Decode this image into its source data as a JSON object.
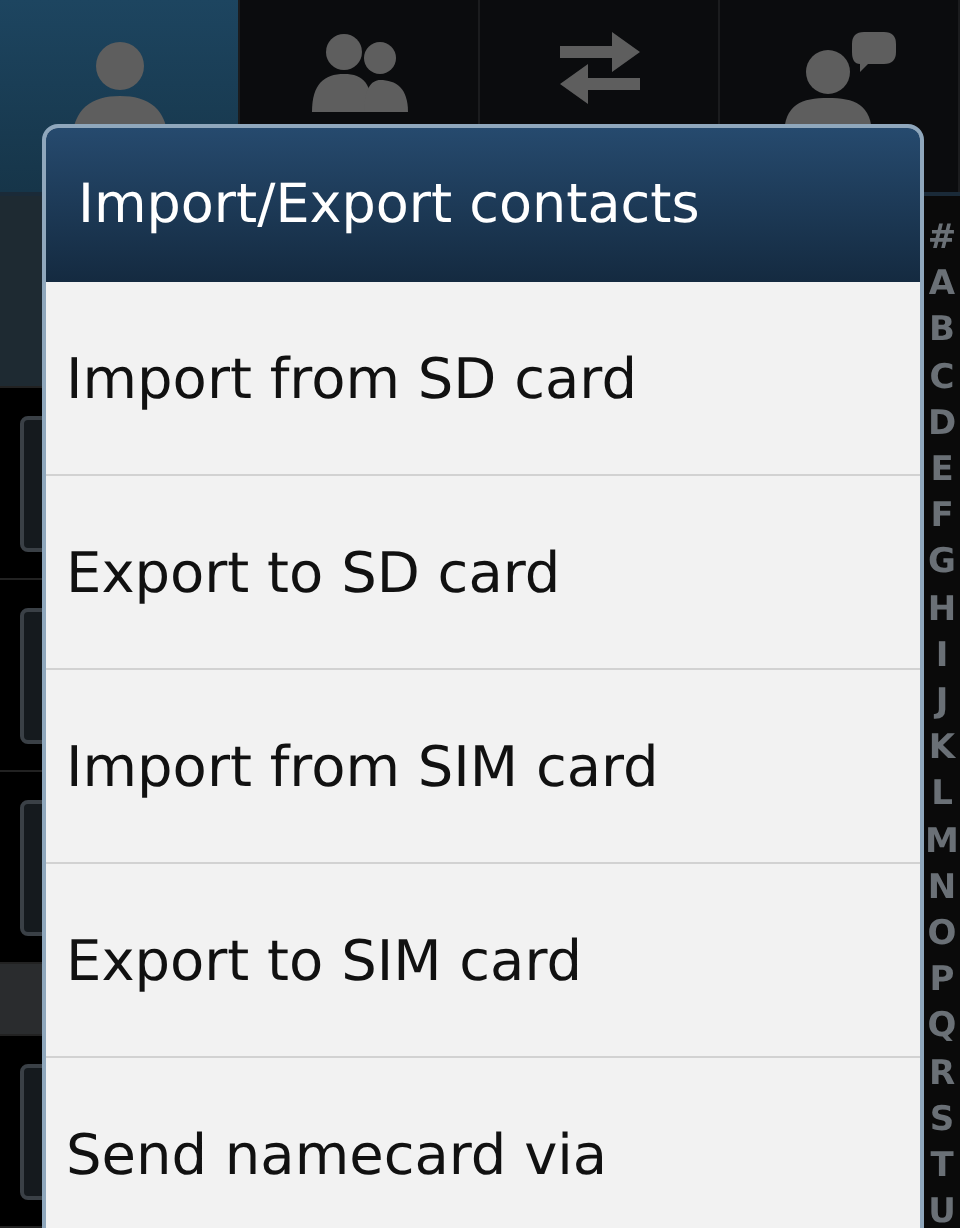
{
  "tabs": [
    {
      "kind": "contact",
      "selected": true
    },
    {
      "kind": "group",
      "selected": false
    },
    {
      "kind": "swap",
      "selected": false
    },
    {
      "kind": "chat",
      "selected": false
    }
  ],
  "index_letters": [
    "#",
    "A",
    "B",
    "C",
    "D",
    "E",
    "F",
    "G",
    "H",
    "I",
    "J",
    "K",
    "L",
    "M",
    "N",
    "O",
    "P",
    "Q",
    "R",
    "S",
    "T",
    "U"
  ],
  "dialog": {
    "title": "Import/Export contacts",
    "items": [
      "Import from SD card",
      "Export to SD card",
      "Import from SIM card",
      "Export to SIM card",
      "Send namecard via"
    ]
  }
}
